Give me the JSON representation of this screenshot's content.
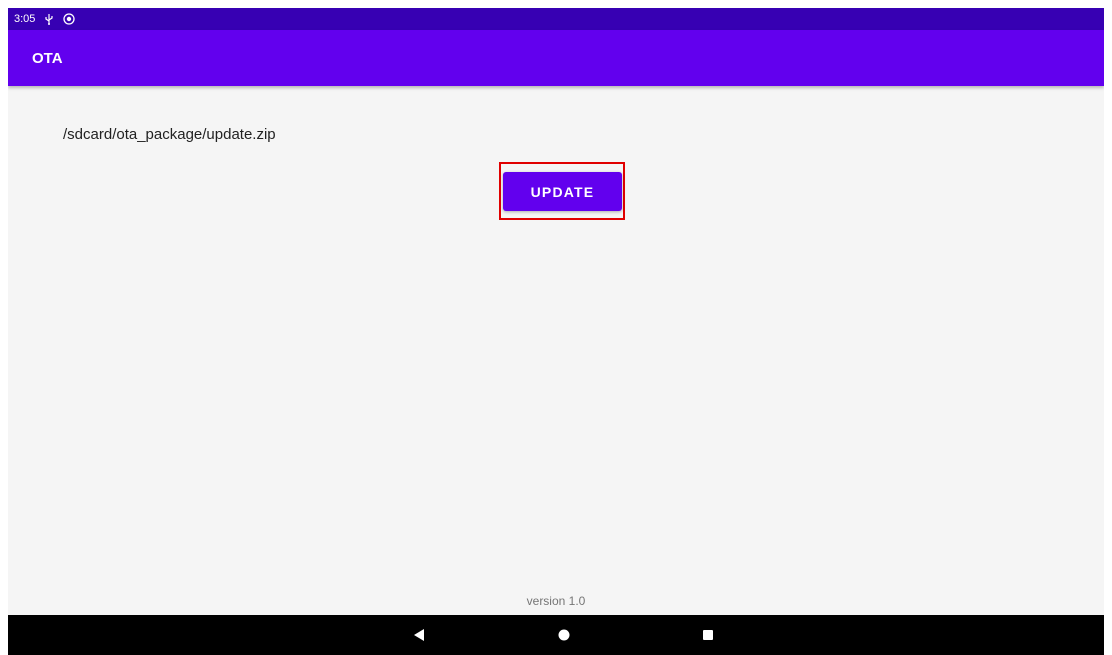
{
  "status_bar": {
    "time": "3:05",
    "icons": [
      "usb-icon",
      "sync-icon"
    ],
    "background": "#3700b3"
  },
  "app_bar": {
    "title": "OTA",
    "background": "#6200ee"
  },
  "main": {
    "package_path": "/sdcard/ota_package/update.zip",
    "update_button_label": "UPDATE",
    "version_label": "version 1.0"
  },
  "highlight": {
    "color": "#e00000",
    "target": "update-button"
  },
  "nav_bar": {
    "buttons": [
      "back-icon",
      "home-icon",
      "recents-icon"
    ]
  }
}
